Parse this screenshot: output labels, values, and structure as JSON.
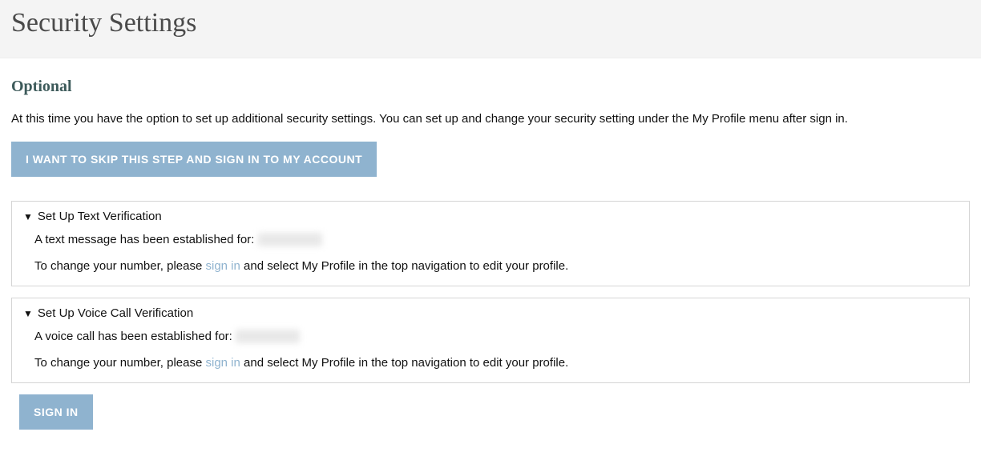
{
  "header": {
    "title": "Security Settings"
  },
  "optional": {
    "heading": "Optional",
    "intro": "At this time you have the option to set up additional security settings. You can set up and change your security setting under the My Profile menu after sign in.",
    "skip_button_label": "I WANT TO SKIP THIS STEP AND SIGN IN TO MY ACCOUNT"
  },
  "panels": {
    "text_verification": {
      "title": "Set Up Text Verification",
      "established_prefix": "A text message has been established for: ",
      "masked_value": "(redacted)",
      "change_prefix": "To change your number, please ",
      "sign_in_link": "sign in",
      "change_suffix": " and select My Profile in the top navigation to edit your profile."
    },
    "voice_verification": {
      "title": "Set Up Voice Call Verification",
      "established_prefix": "A voice call has been established for: ",
      "masked_value": "(redacted)",
      "change_prefix": "To change your number, please ",
      "sign_in_link": "sign in",
      "change_suffix": " and select My Profile in the top navigation to edit your profile."
    }
  },
  "sign_in_button_label": "SIGN IN",
  "icons": {
    "disclosure": "▼"
  }
}
